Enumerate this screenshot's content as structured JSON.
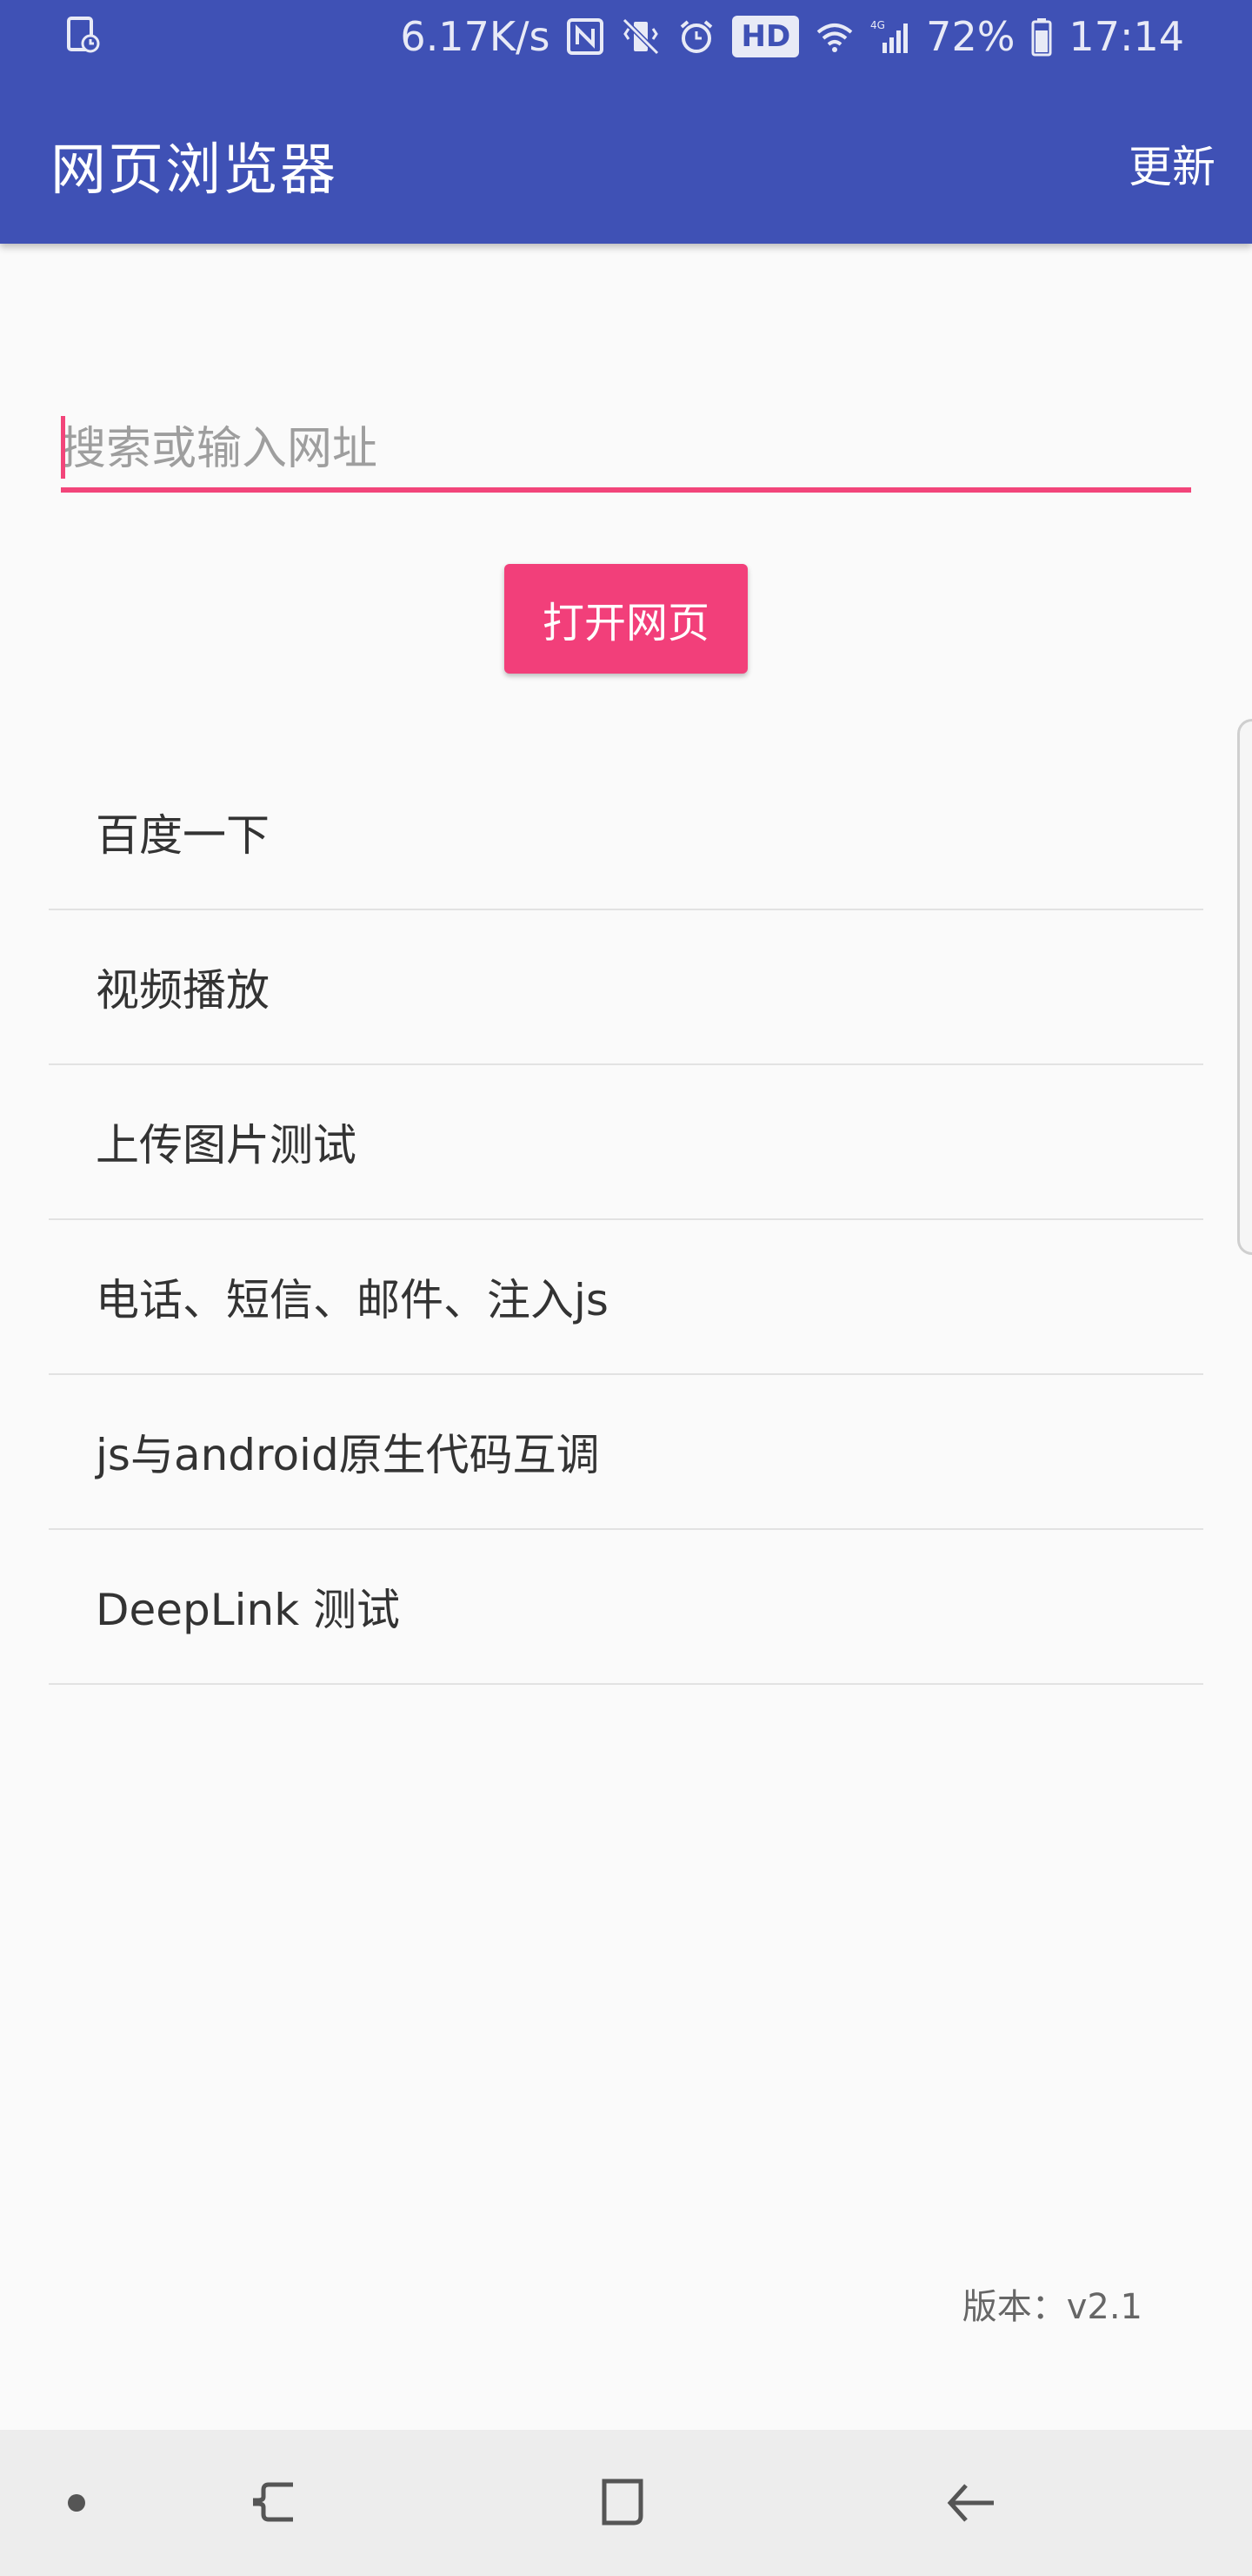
{
  "status_bar": {
    "network_speed": "6.17K/s",
    "hd": "HD",
    "signal_label": "4G",
    "battery": "72%",
    "time": "17:14",
    "icons": [
      "screen-timer-icon",
      "nfc-icon",
      "vibrate-icon",
      "alarm-icon",
      "hd-icon",
      "wifi-icon",
      "cell-signal-icon",
      "battery-icon"
    ]
  },
  "app_bar": {
    "title": "网页浏览器",
    "update_label": "更新"
  },
  "search": {
    "placeholder": "搜索或输入网址",
    "value": ""
  },
  "open_button_label": "打开网页",
  "list": {
    "items": [
      {
        "label": "百度一下"
      },
      {
        "label": "视频播放"
      },
      {
        "label": "上传图片测试"
      },
      {
        "label": "电话、短信、邮件、注入js"
      },
      {
        "label": "js与android原生代码互调"
      },
      {
        "label": "DeepLink 测试"
      }
    ]
  },
  "version_text": "版本：v2.1",
  "nav_bar": {
    "icons": [
      "dot-icon",
      "recent-apps-icon",
      "home-icon",
      "back-icon"
    ]
  },
  "colors": {
    "primary": "#3f51b5",
    "accent": "#f23f7a",
    "background": "#fafafa"
  }
}
